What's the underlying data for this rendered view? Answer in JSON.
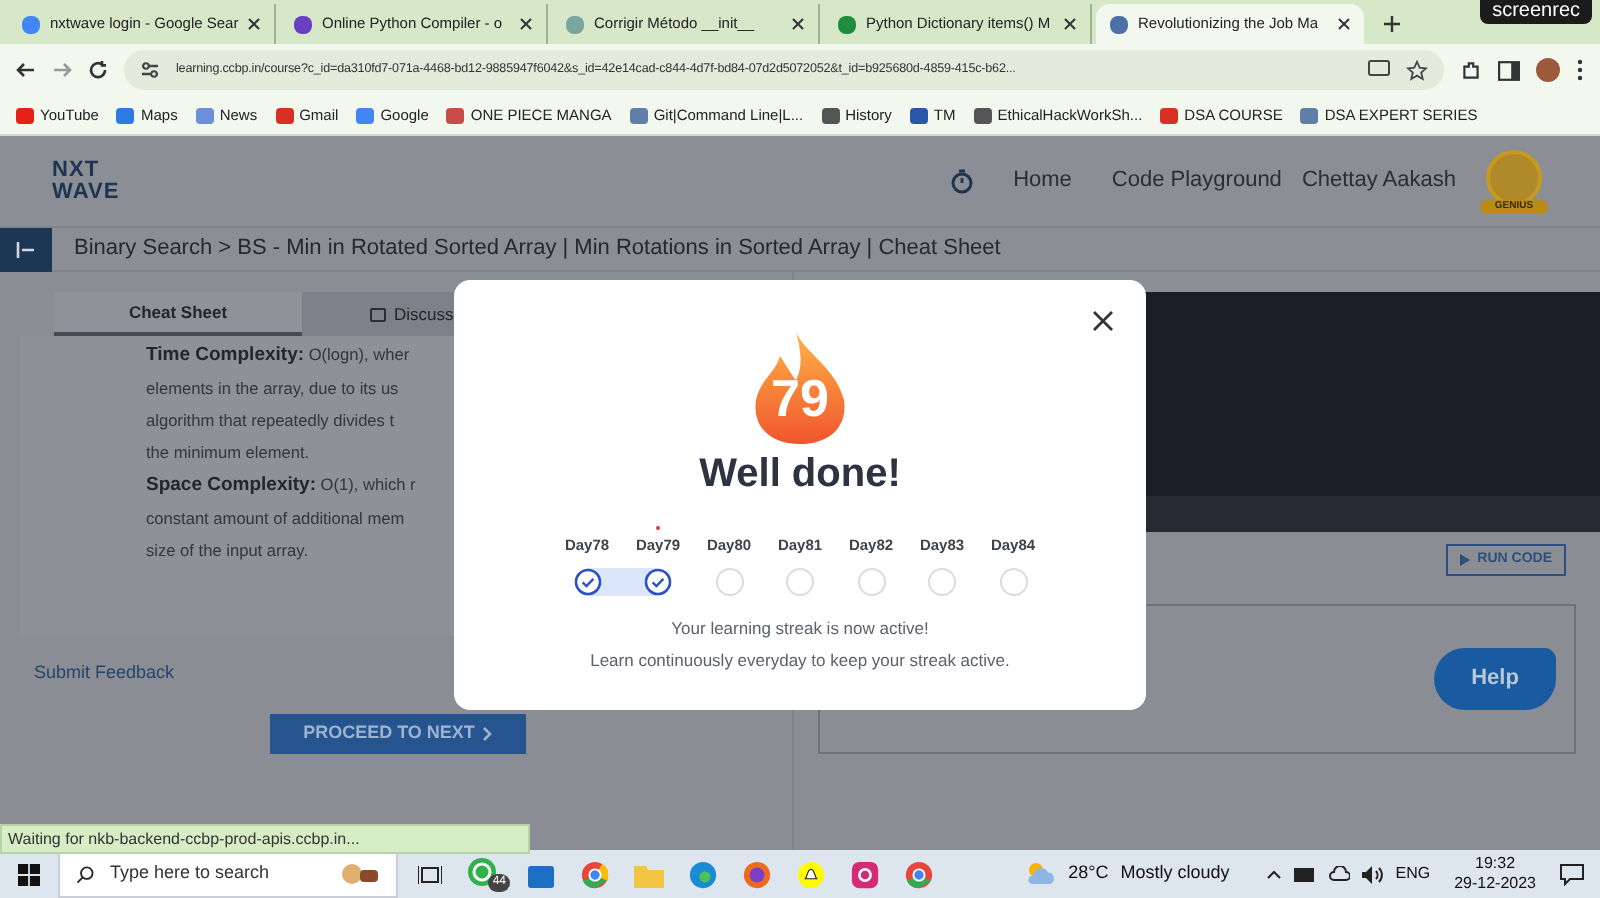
{
  "browser": {
    "tabs": [
      {
        "title": "nxtwave login - Google Sear",
        "selected": false
      },
      {
        "title": "Online Python Compiler - o",
        "selected": false
      },
      {
        "title": "Corrigir Método __init__",
        "selected": false
      },
      {
        "title": "Python Dictionary items() M",
        "selected": false
      },
      {
        "title": "Revolutionizing the Job Ma",
        "selected": true
      }
    ],
    "recorder": "screenrec",
    "address": "learning.ccbp.in/course?c_id=da310fd7-071a-4468-bd12-9885947f6042&s_id=42e14cad-c844-4d7f-bd84-07d2d5072052&t_id=b925680d-4859-415c-b62...",
    "bookmarks": [
      "YouTube",
      "Maps",
      "News",
      "Gmail",
      "Google",
      "ONE PIECE MANGA",
      "Git|Command Line|L...",
      "History",
      "TM",
      "EthicalHackWorkSh...",
      "DSA COURSE",
      "DSA EXPERT SERIES"
    ]
  },
  "page": {
    "logo": [
      "NXT",
      "WAVE"
    ],
    "nav": [
      "Home",
      "Code Playground"
    ],
    "user": "Chettay Aakash",
    "badge": "GENIUS",
    "breadcrumb": "Binary Search > BS - Min in Rotated Sorted Array | Min Rotations in Sorted Array | Cheat Sheet",
    "content_tabs": [
      {
        "label": "Cheat Sheet",
        "selected": true
      },
      {
        "label": "Discuss",
        "selected": false
      }
    ],
    "lines": [
      "**Time Complexity:** O(logn), wher",
      "elements in the array, due to its us",
      "algorithm that repeatedly divides t",
      "the minimum element.",
      "**Space Complexity:** O(1), which r",
      "constant amount of additional mem",
      "size of the input array."
    ],
    "submit_feedback": "Submit Feedback",
    "proceed": "PROCEED TO NEXT",
    "run_code": "RUN CODE",
    "help": "Help"
  },
  "modal": {
    "streak": "79",
    "title": "Well done!",
    "days": [
      {
        "label": "Day78",
        "done": true,
        "today": false
      },
      {
        "label": "Day79",
        "done": true,
        "today": true
      },
      {
        "label": "Day80",
        "done": false,
        "today": false
      },
      {
        "label": "Day81",
        "done": false,
        "today": false
      },
      {
        "label": "Day82",
        "done": false,
        "today": false
      },
      {
        "label": "Day83",
        "done": false,
        "today": false
      },
      {
        "label": "Day84",
        "done": false,
        "today": false
      }
    ],
    "messages": [
      "Your learning streak is now active!",
      "Learn continuously everyday to keep your streak active."
    ]
  },
  "status_bubble": "Waiting for nkb-backend-ccbp-prod-apis.ccbp.in...",
  "taskbar": {
    "search_placeholder": "Type here to search",
    "whatsapp_badge": "44",
    "temperature": "28°C",
    "weather": "Mostly cloudy",
    "language": "ENG",
    "time": "19:32",
    "date": "29-12-2023"
  }
}
